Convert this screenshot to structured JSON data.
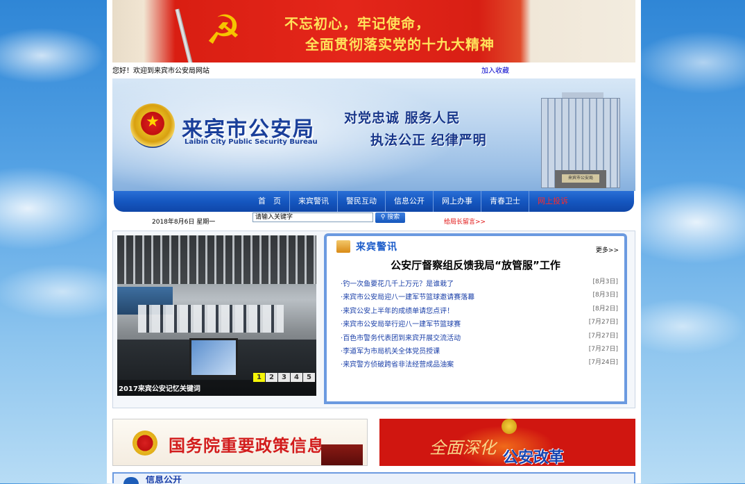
{
  "party_banner": {
    "line1": "不忘初心，牢记使命，",
    "line2": "全面贯彻落实党的十九大精神"
  },
  "welcome": {
    "text": "您好！欢迎到来宾市公安局网站",
    "bookmark": "加入收藏"
  },
  "header": {
    "title_cn": "来宾市公安局",
    "title_en": "Laibin City Public Security Bureau",
    "motto_line1": "对党忠诚  服务人民",
    "motto_line2": "执法公正  纪律严明",
    "building_plate": "来宾市公安局"
  },
  "nav": {
    "items": [
      "首　页",
      "来宾警讯",
      "警民互动",
      "信息公开",
      "网上办事",
      "青春卫士",
      "网上投诉"
    ]
  },
  "toolbar": {
    "date": "2018年8月6日  星期一",
    "search_value": "请输入关键字",
    "search_button": "搜索",
    "chief_message": "给局长留言>>"
  },
  "slider": {
    "caption": "2017来宾公安记忆关键词",
    "pages": [
      "1",
      "2",
      "3",
      "4",
      "5"
    ],
    "active_page": "1"
  },
  "news": {
    "title": "来宾警讯",
    "more": "更多>>",
    "headline": "公安厅督察组反馈我局“放管服”工作",
    "items": [
      {
        "title": "钓一次鱼要花几千上万元？是谁栽了",
        "date": "[8月3日]"
      },
      {
        "title": "来宾市公安局迎八一建军节篮球邀请赛落幕",
        "date": "[8月3日]"
      },
      {
        "title": "来宾公安上半年的成绩单请您点评！",
        "date": "[8月2日]"
      },
      {
        "title": "来宾市公安局举行迎八一建军节篮球赛",
        "date": "[7月27日]"
      },
      {
        "title": "百色市警务代表团到来宾开展交流活动",
        "date": "[7月27日]"
      },
      {
        "title": "李道军为市局机关全体党员授课",
        "date": "[7月27日]"
      },
      {
        "title": "来宾警方侦破跨省非法经营成品油案",
        "date": "[7月24日]"
      }
    ]
  },
  "banners": {
    "state_council": "国务院重要政策信息",
    "reform_callig": "全面深化",
    "reform_text": "公安改革"
  },
  "bottom_section": {
    "title": "信息公开"
  }
}
